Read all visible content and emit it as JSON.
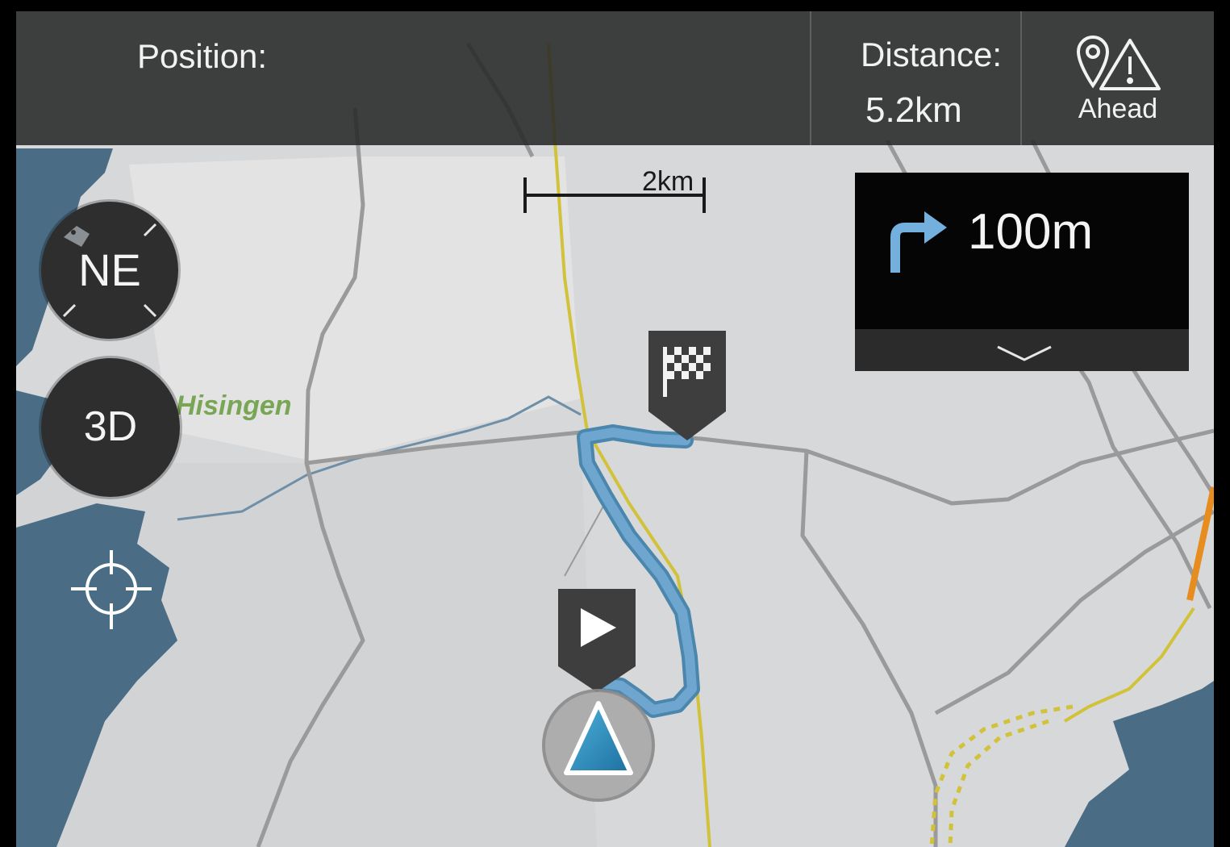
{
  "header": {
    "position_label": "Position:",
    "distance_label": "Distance:",
    "distance_value": "5.2km",
    "ahead_label": "Ahead"
  },
  "map": {
    "scale_label": "2km",
    "place_label": "Hisingen",
    "compass_heading": "NE",
    "view_mode_label": "3D"
  },
  "turn_card": {
    "distance": "100m",
    "direction": "right"
  },
  "icons": {
    "ahead": [
      "pin-icon",
      "warning-icon"
    ],
    "turn": "turn-right-arrow-icon",
    "expand": "chevron-down-icon",
    "destination": "checkered-flag-icon",
    "play": "play-icon",
    "locate": "crosshair-icon",
    "vehicle": "vehicle-position-icon"
  },
  "colors": {
    "route": "#6fa6cf",
    "water": "#4a6c85",
    "map_land": "#d7d8da",
    "major_road": "#d1c23a",
    "motorway": "#e78c1e",
    "place_label": "#79a655"
  }
}
